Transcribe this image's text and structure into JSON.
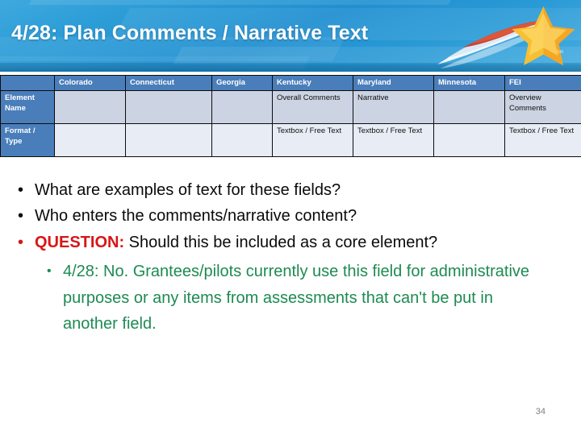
{
  "slide": {
    "title": "4/28: Plan Comments / Narrative Text",
    "page_number": "34",
    "logo_trademark": "SM",
    "accent_banner_color": "#1f8fd0",
    "table_header_color": "#4a7ebb",
    "question_color": "#d81616",
    "answer_color": "#1d8a52"
  },
  "table": {
    "corner_label": "",
    "columns": [
      "Colorado",
      "Connecticut",
      "Georgia",
      "Kentucky",
      "Maryland",
      "Minnesota",
      "FEI"
    ],
    "rows": [
      {
        "label": "Element Name",
        "cells": [
          "",
          "",
          "",
          "Overall Comments",
          "Narrative",
          "",
          "Overview Comments"
        ]
      },
      {
        "label": "Format / Type",
        "cells": [
          "",
          "",
          "",
          "Textbox / Free Text",
          "Textbox / Free Text",
          "",
          "Textbox / Free Text"
        ]
      }
    ]
  },
  "bullets": {
    "items": [
      {
        "marker": "•",
        "text": "What are examples of text for these fields?"
      },
      {
        "marker": "•",
        "text": "Who enters the comments/narrative content?"
      },
      {
        "marker": "•",
        "emphasis": "QUESTION:",
        "text": " Should this be included as a core element?"
      }
    ],
    "answer": {
      "marker": "•",
      "text": "4/28: No. Grantees/pilots currently use this field for administrative purposes or any items from assessments that can't be put in another field."
    }
  }
}
